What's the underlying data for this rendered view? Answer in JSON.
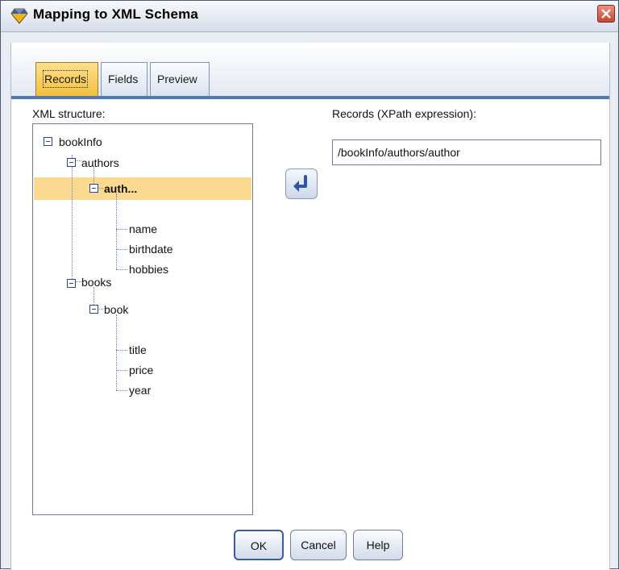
{
  "window": {
    "title": "Mapping to XML Schema",
    "icon": "diamond-app-icon",
    "close_icon": "close-icon"
  },
  "tabs": [
    {
      "label": "Records",
      "active": true
    },
    {
      "label": "Fields",
      "active": false
    },
    {
      "label": "Preview",
      "active": false
    }
  ],
  "structure": {
    "label": "XML structure:",
    "tree": [
      {
        "text": "bookInfo",
        "expanded": true
      },
      {
        "text": "authors",
        "expanded": true
      },
      {
        "text": "auth...",
        "expanded": true,
        "selected": true
      },
      {
        "text": "name"
      },
      {
        "text": "birthdate"
      },
      {
        "text": "hobbies"
      },
      {
        "text": "books",
        "expanded": true
      },
      {
        "text": "book",
        "expanded": true
      },
      {
        "text": "title"
      },
      {
        "text": "price"
      },
      {
        "text": "year"
      }
    ]
  },
  "records": {
    "label": "Records (XPath expression):",
    "value": "/bookInfo/authors/author",
    "insert_icon": "left-arrow-icon"
  },
  "buttons": {
    "ok": "OK",
    "cancel": "Cancel",
    "help": "Help"
  },
  "colors": {
    "selection": "#fcd990",
    "active_tab": "#f5bf3c",
    "tab_strip_rule": "#4f78b8"
  }
}
